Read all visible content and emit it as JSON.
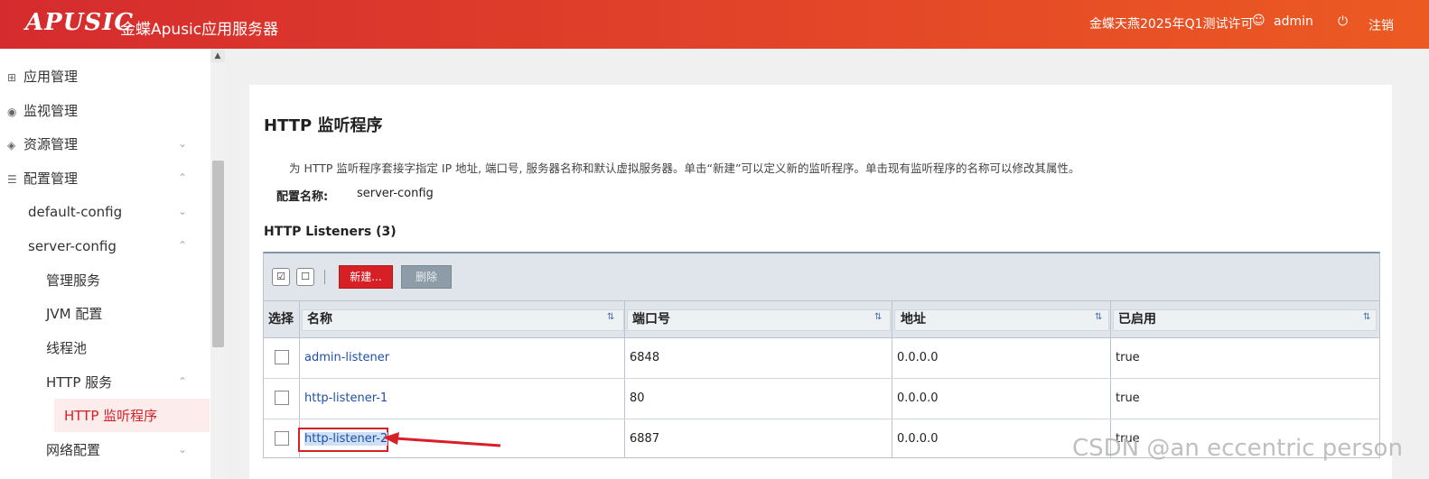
{
  "header": {
    "logo": "APUSIC",
    "product": "金蝶Apusic应用服务器",
    "license": "金蝶天燕2025年Q1测试许可",
    "user": "admin",
    "logout": "注销"
  },
  "sidebar": {
    "items": [
      {
        "label": "应用管理"
      },
      {
        "label": "监视管理"
      },
      {
        "label": "资源管理"
      },
      {
        "label": "配置管理"
      },
      {
        "label": "default-config"
      },
      {
        "label": "server-config"
      },
      {
        "label": "管理服务"
      },
      {
        "label": "JVM 配置"
      },
      {
        "label": "线程池"
      },
      {
        "label": "HTTP 服务"
      },
      {
        "label": "HTTP 监听程序"
      },
      {
        "label": "网络配置"
      }
    ]
  },
  "main": {
    "title": "HTTP 监听程序",
    "description": "为 HTTP 监听程序套接字指定 IP 地址, 端口号, 服务器名称和默认虚拟服务器。单击“新建”可以定义新的监听程序。单击现有监听程序的名称可以修改其属性。",
    "config_label": "配置名称:",
    "config_value": "server-config",
    "section_title": "HTTP Listeners (3)"
  },
  "toolbar": {
    "new_label": "新建...",
    "delete_label": "删除"
  },
  "table": {
    "columns": [
      "选择",
      "名称",
      "端口号",
      "地址",
      "已启用"
    ],
    "rows": [
      {
        "name": "admin-listener",
        "port": "6848",
        "address": "0.0.0.0",
        "enabled": "true"
      },
      {
        "name": "http-listener-1",
        "port": "80",
        "address": "0.0.0.0",
        "enabled": "true"
      },
      {
        "name": "http-listener-2",
        "port": "6887",
        "address": "0.0.0.0",
        "enabled": "true"
      }
    ]
  },
  "watermark": "CSDN @an eccentric person",
  "colors": {
    "header_start": "#d52b2e",
    "header_end": "#ec5a22",
    "accent_red": "#d71f26",
    "link_blue": "#1f4fa8"
  }
}
